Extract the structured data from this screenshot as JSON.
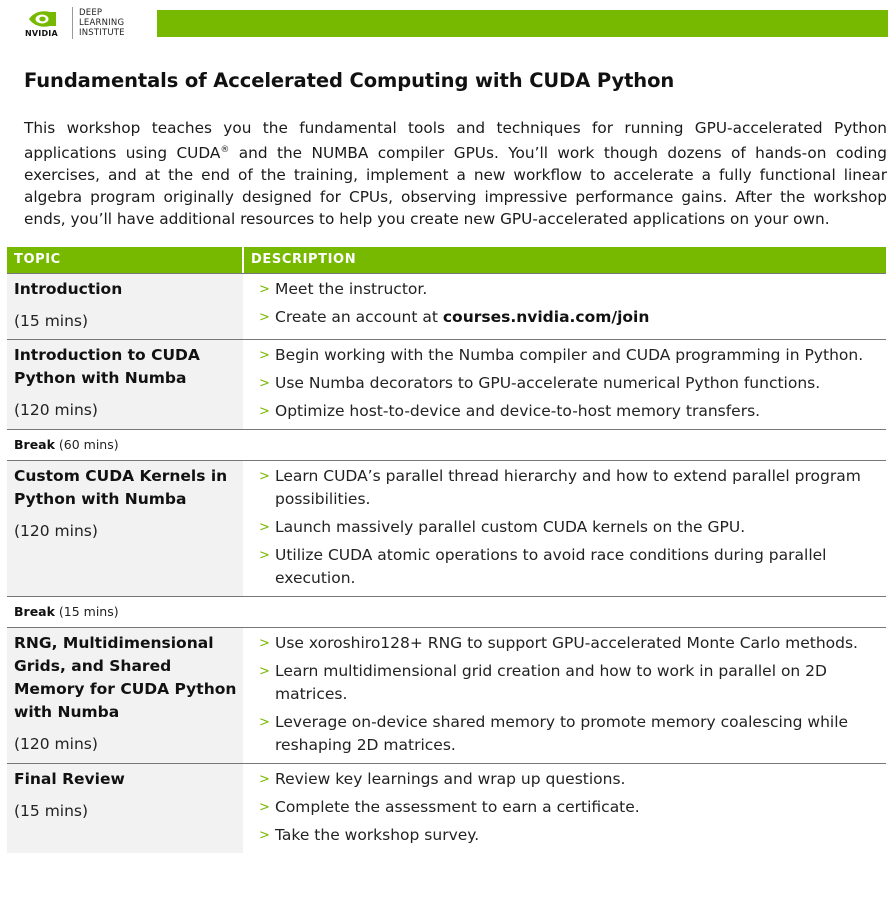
{
  "header": {
    "brand": "NVIDIA",
    "dli_lines": [
      "DEEP",
      "LEARNING",
      "INSTITUTE"
    ],
    "brand_color": "#77b900"
  },
  "title": "Fundamentals of Accelerated Computing with CUDA Python",
  "intro": {
    "part1": "This workshop teaches you the fundamental tools and techniques for running GPU-accelerated Python applications using CUDA",
    "sup": "®",
    "part2": " and the NUMBA compiler GPUs. You’ll work though dozens of hands-on coding exercises, and at the end of the training, implement a new workflow to accelerate a fully functional linear algebra program originally designed for CPUs, observing impressive performance gains. After the workshop ends, you’ll have additional resources to help you create new GPU-accelerated applications on your own."
  },
  "table": {
    "headers": {
      "topic": "TOPIC",
      "description": "DESCRIPTION"
    },
    "arrow": ">",
    "rows": [
      {
        "topic": "Introduction",
        "duration": "(15 mins)",
        "items": [
          {
            "text": "Meet the instructor."
          },
          {
            "text": "Create an account at ",
            "bold": "courses.nvidia.com/join"
          }
        ]
      },
      {
        "topic": "Introduction to CUDA Python with Numba",
        "duration": "(120 mins)",
        "items": [
          {
            "text": "Begin working with the Numba compiler and CUDA programming in Python."
          },
          {
            "text": "Use Numba decorators to GPU-accelerate numerical Python functions."
          },
          {
            "text": "Optimize host-to-device and device-to-host memory transfers."
          }
        ]
      },
      {
        "topic": "Custom CUDA Kernels in Python with Numba",
        "duration": "(120 mins)",
        "items": [
          {
            "text": "Learn CUDA’s parallel thread hierarchy and how to extend parallel program possibilities."
          },
          {
            "text": "Launch massively parallel custom CUDA kernels on the GPU."
          },
          {
            "text": "Utilize CUDA atomic operations to avoid race conditions during parallel execution."
          }
        ]
      },
      {
        "topic": "RNG, Multidimensional Grids, and Shared Memory for CUDA Python with Numba",
        "duration": "(120 mins)",
        "items": [
          {
            "text": "Use xoroshiro128+ RNG to support GPU-accelerated Monte Carlo methods."
          },
          {
            "text": "Learn multidimensional grid creation and how to work in parallel on 2D matrices."
          },
          {
            "text": "Leverage on-device shared memory to promote memory coalescing while reshaping 2D matrices."
          }
        ]
      },
      {
        "topic": "Final Review",
        "duration": "(15 mins)",
        "items": [
          {
            "text": "Review key learnings and wrap up questions."
          },
          {
            "text": "Complete the assessment to earn a certificate."
          },
          {
            "text": "Take the workshop survey."
          }
        ]
      }
    ],
    "breaks": [
      {
        "label": "Break",
        "duration": "(60 mins)"
      },
      {
        "label": "Break",
        "duration": "(15 mins)"
      }
    ]
  }
}
